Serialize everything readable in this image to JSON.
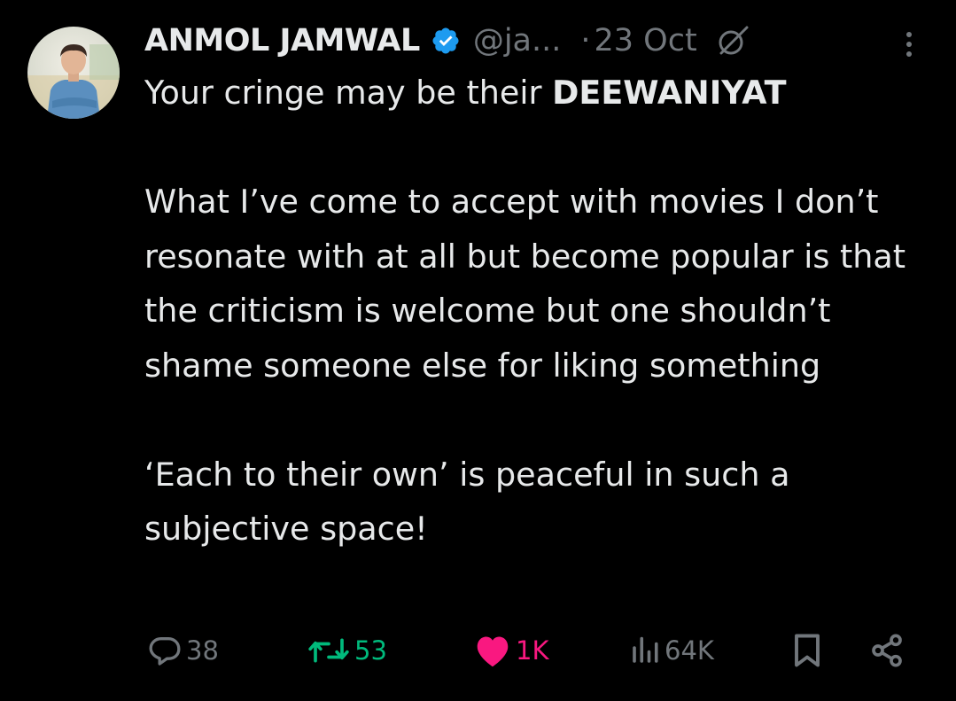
{
  "author": {
    "name": "ANMOL JAMWAL",
    "handle": "@ja...",
    "separator": "·",
    "date": "23 Oct",
    "verified": true
  },
  "icons": {
    "verified": "verified-badge-icon",
    "grok": "grok-icon",
    "more": "more-dots-icon",
    "reply": "reply-icon",
    "retweet": "retweet-icon",
    "like": "heart-icon",
    "views": "views-icon",
    "bookmark": "bookmark-icon",
    "share": "share-icon"
  },
  "tweet": {
    "line1_normal": "Your cringe may be their ",
    "line1_bold": "DEEWANIYAT",
    "paragraph2": "What I’ve come to accept with movies I don’t resonate with at all but become popular is that the criticism is welcome but one shouldn’t shame someone else for liking something",
    "paragraph3": "‘Each to their own’ is peaceful in such a subjective space!"
  },
  "stats": {
    "replies": "38",
    "retweets": "53",
    "likes": "1K",
    "views": "64K"
  },
  "colors": {
    "background": "#000000",
    "text": "#e7e9ea",
    "muted": "#71767b",
    "verified": "#1d9bf0",
    "retweet_active": "#00ba7c",
    "like_active": "#f91880"
  }
}
